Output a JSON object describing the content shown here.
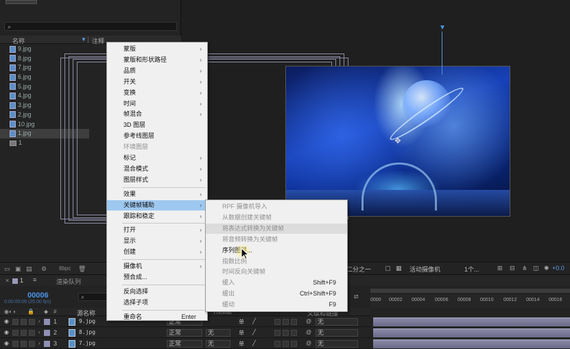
{
  "project": {
    "search_icon": "search-icon",
    "header": {
      "name": "名称",
      "note": "注释"
    },
    "files": [
      "9.jpg",
      "8.jpg",
      "7.jpg",
      "6.jpg",
      "5.jpg",
      "4.jpg",
      "3.jpg",
      "2.jpg",
      "10.jpg",
      "1.jpg"
    ],
    "folder": "1",
    "bpc": "8bpc"
  },
  "viewer": {
    "zoom": "二分之一",
    "camera": "活动摄像机",
    "view": "1个...",
    "exposure": "+0.0"
  },
  "timeline": {
    "tab_comp": "1",
    "tab_render": "渲染队列",
    "timecode": "00006",
    "timecode_sub": "0:00:00:06 (25.00 fps)",
    "search_icon": "search-icon",
    "col_name": "源名称",
    "col_mode": "TrkMat",
    "col_parent": "父级和链接",
    "ticks": [
      "0000",
      "00002",
      "00004",
      "00006",
      "00008",
      "00010",
      "00012",
      "00014",
      "00016"
    ],
    "layers": [
      {
        "num": "1",
        "name": "9.jpg",
        "mode": "正常",
        "trkmat": "",
        "parent": "无"
      },
      {
        "num": "2",
        "name": "8.jpg",
        "mode": "正常",
        "trkmat": "无",
        "parent": "无"
      },
      {
        "num": "3",
        "name": "7.jpg",
        "mode": "正常",
        "trkmat": "无",
        "parent": "无"
      }
    ]
  },
  "context_menu": {
    "items": [
      {
        "label": "蒙版",
        "submenu": true
      },
      {
        "label": "蒙版和形状路径",
        "submenu": true
      },
      {
        "label": "品质",
        "submenu": true
      },
      {
        "label": "开关",
        "submenu": true
      },
      {
        "label": "变换",
        "submenu": true
      },
      {
        "label": "时间",
        "submenu": true
      },
      {
        "label": "帧混合",
        "submenu": true
      },
      {
        "label": "3D 图层"
      },
      {
        "label": "参考线图层"
      },
      {
        "label": "环境图层",
        "disabled": true
      },
      {
        "label": "标记",
        "submenu": true
      },
      {
        "label": "混合模式",
        "submenu": true
      },
      {
        "label": "图层样式",
        "submenu": true
      },
      {
        "label": "效果",
        "submenu": true
      },
      {
        "label": "关键帧辅助",
        "submenu": true,
        "highlighted": true
      },
      {
        "label": "跟踪和稳定",
        "submenu": true
      },
      {
        "label": "打开",
        "submenu": true
      },
      {
        "label": "显示",
        "submenu": true
      },
      {
        "label": "创建",
        "submenu": true
      },
      {
        "label": "摄像机",
        "submenu": true
      },
      {
        "label": "预合成..."
      },
      {
        "label": "反向选择"
      },
      {
        "label": "选择子项"
      },
      {
        "label": "重命名",
        "shortcut": "Enter"
      }
    ]
  },
  "keyframe_submenu": {
    "items": [
      {
        "label": "RPF 摄像机导入",
        "disabled": true
      },
      {
        "label": "从数据创建关键帧",
        "disabled": true
      },
      {
        "label": "将表达式转换为关键帧",
        "disabled": true,
        "hover": true
      },
      {
        "label": "将音频转换为关键帧",
        "disabled": true
      },
      {
        "label": "序列图层..."
      },
      {
        "label": "指数比例",
        "disabled": true
      },
      {
        "label": "时间反向关键帧",
        "disabled": true
      },
      {
        "label": "缓入",
        "shortcut": "Shift+F9",
        "disabled": true
      },
      {
        "label": "缓出",
        "shortcut": "Ctrl+Shift+F9",
        "disabled": true
      },
      {
        "label": "缓动",
        "shortcut": "F9",
        "disabled": true
      }
    ]
  },
  "colors": {
    "menu_bg": "#f0f0f0",
    "menu_highlight": "#9ec8f0",
    "accent_blue": "#4a95e8",
    "layer_bar": "#8a8aa8"
  }
}
